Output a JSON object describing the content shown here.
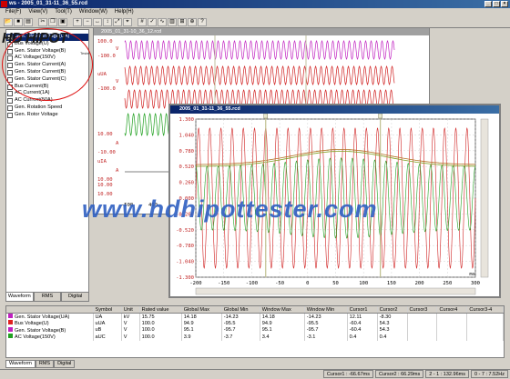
{
  "app": {
    "title": "ws - 2005_01_31-11_36_55.rcd"
  },
  "menu": [
    "File(F)",
    "View(V)",
    "Tool(T)",
    "Window(W)",
    "Help(H)"
  ],
  "logo": {
    "text": "HD HIPOT",
    "sub": "Tester"
  },
  "channels": [
    {
      "label": "Gen. Stator Voltage(UA)",
      "selected": true
    },
    {
      "label": "Bus Voltage(U)",
      "selected": false
    },
    {
      "label": "Gen. Stator Voltage(B)",
      "selected": false
    },
    {
      "label": "AC Voltage(150V)",
      "selected": false
    },
    {
      "label": "Gen. Stator Current(A)",
      "selected": false
    },
    {
      "label": "Gen. Stator Current(B)",
      "selected": false
    },
    {
      "label": "Gen. Stator Current(C)",
      "selected": false
    },
    {
      "label": "Bus Current(B)",
      "selected": false
    },
    {
      "label": "AC Current(1A)",
      "selected": false
    },
    {
      "label": "AC Current(50A)",
      "selected": false
    },
    {
      "label": "Gen. Rotation Speed",
      "selected": false
    },
    {
      "label": "Gen. Rotor Voltage",
      "selected": false
    }
  ],
  "leftTabs": [
    "Waveform",
    "RMS",
    "Digital"
  ],
  "backWindow": {
    "title": "2005_01_31-10_36_12.rcd",
    "axis_labels": [
      "100.0",
      "V",
      "-100.0",
      "uUA",
      "V",
      "-100.0",
      "10.00",
      "A",
      "-10.00",
      "uIA",
      "A",
      "10.00",
      "10.00",
      "10.00"
    ],
    "x_ticks": [
      "-500",
      "400"
    ]
  },
  "frontWindow": {
    "title": "2005_01_31-11_36_55.rcd",
    "xlabel": "ms"
  },
  "chart_data": {
    "type": "line",
    "title": "",
    "x_ticks": [
      -200,
      -150,
      -100,
      -50,
      0,
      50,
      100,
      150,
      200,
      250,
      300
    ],
    "y_ticks": [
      1.3,
      1.04,
      0.78,
      0.52,
      0.26,
      0.0,
      -0.26,
      -0.52,
      -0.78,
      -1.04,
      -1.3
    ],
    "y_tick_labels": [
      "1.300",
      "1.040",
      "0.780",
      "0.520",
      "0.260",
      "0.000",
      "-0.260",
      "-0.520",
      "-0.780",
      "-1.040",
      "-1.300"
    ],
    "xlim": [
      -200,
      300
    ],
    "ylim": [
      -1.3,
      1.3
    ],
    "xlabel": "ms",
    "cursors": [
      -75,
      130
    ],
    "grid": true,
    "series": [
      {
        "color": "#d02020",
        "period_ms": 20,
        "amplitude": 1.15
      },
      {
        "color": "#20a020",
        "period_ms": 20,
        "amplitude": 0.55,
        "phase": 0.25
      }
    ]
  },
  "table": {
    "headers": [
      "",
      "Symbol",
      "Unit",
      "Rated value",
      "Global Max",
      "Global Min",
      "Window Max",
      "Window Min",
      "Cursor1",
      "Cursor2",
      "Cursor3",
      "Cursor4",
      "Cursor3-4"
    ],
    "rows": [
      [
        "Gen. Stator Voltage(UA)",
        "UA",
        "kV",
        "15.75",
        "14.18",
        "-14.23",
        "14.18",
        "-14.23",
        "12.11",
        "-8.30",
        "",
        "",
        ""
      ],
      [
        "Bus Voltage(U)",
        "uUA",
        "V",
        "100.0",
        "94.9",
        "-95.5",
        "94.9",
        "-95.5",
        "-60.4",
        "54.3",
        "",
        "",
        ""
      ],
      [
        "Gen. Stator Voltage(B)",
        "uB",
        "V",
        "100.0",
        "95.1",
        "-95.7",
        "95.1",
        "-95.7",
        "-60.4",
        "54.3",
        "",
        "",
        ""
      ],
      [
        "AC Voltage(150V)",
        "aUC",
        "V",
        "100.0",
        "3.9",
        "-3.7",
        "3.4",
        "-3.1",
        "0.4",
        "0.4",
        "",
        "",
        ""
      ]
    ],
    "row_colors": [
      "#c020c0",
      "#e02020",
      "#c020c0",
      "#20a020"
    ]
  },
  "bottomTabs": [
    "Waveform",
    "RMS",
    "Digital"
  ],
  "status": [
    "Cursor1 : -66.67ms",
    "Cursor2 : 66.29ms",
    "2 - 1 : 132.96ms",
    "0 - 7 : 7.52Hz"
  ],
  "watermark": "www.hdhipottester.com"
}
